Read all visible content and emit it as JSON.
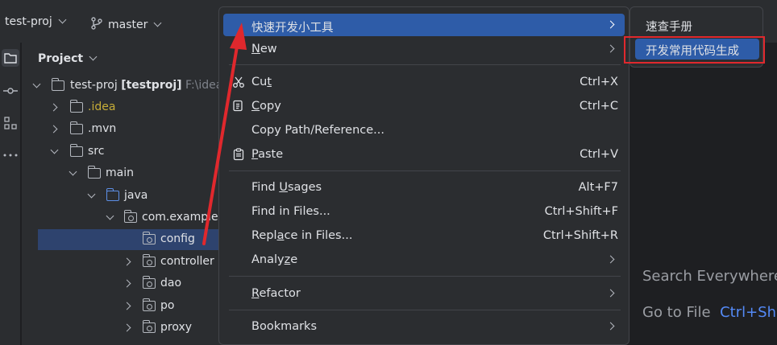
{
  "topbar": {
    "project_name": "test-proj",
    "branch": "master"
  },
  "project_panel": {
    "title": "Project",
    "tree": [
      {
        "label": "test-proj",
        "bold_suffix": "[testproj]",
        "path": "F:\\idea"
      },
      {
        "label": ".idea"
      },
      {
        "label": ".mvn"
      },
      {
        "label": "src"
      },
      {
        "label": "main"
      },
      {
        "label": "java"
      },
      {
        "label": "com.example"
      },
      {
        "label": "config"
      },
      {
        "label": "controller"
      },
      {
        "label": "dao"
      },
      {
        "label": "po"
      },
      {
        "label": "proxy"
      }
    ]
  },
  "menu": {
    "items": [
      {
        "label": "快速开发小工具"
      },
      {
        "label_pre": "",
        "label_u": "N",
        "label_post": "ew"
      },
      {
        "label_pre": "Cu",
        "label_u": "t",
        "label_post": "",
        "shortcut": "Ctrl+X"
      },
      {
        "label_pre": "",
        "label_u": "C",
        "label_post": "opy",
        "shortcut": "Ctrl+C"
      },
      {
        "label": "Copy Path/Reference..."
      },
      {
        "label_pre": "",
        "label_u": "P",
        "label_post": "aste",
        "shortcut": "Ctrl+V"
      },
      {
        "label_pre": "Find ",
        "label_u": "U",
        "label_post": "sages",
        "shortcut": "Alt+F7"
      },
      {
        "label": "Find in Files...",
        "shortcut": "Ctrl+Shift+F"
      },
      {
        "label_pre": "Repl",
        "label_u": "a",
        "label_post": "ce in Files...",
        "shortcut": "Ctrl+Shift+R"
      },
      {
        "label_pre": "Analy",
        "label_u": "z",
        "label_post": "e"
      },
      {
        "label_pre": "",
        "label_u": "R",
        "label_post": "efactor"
      },
      {
        "label": "Bookmarks"
      }
    ]
  },
  "submenu": {
    "items": [
      {
        "label": "速查手册"
      },
      {
        "label": "开发常用代码生成"
      }
    ]
  },
  "hints": {
    "search_everywhere": "Search Everywhere",
    "go_to_file": "Go to File",
    "go_to_file_key": "Ctrl+Sh"
  },
  "colors": {
    "accent": "#2e5ca8",
    "annotation": "#e0282d"
  }
}
